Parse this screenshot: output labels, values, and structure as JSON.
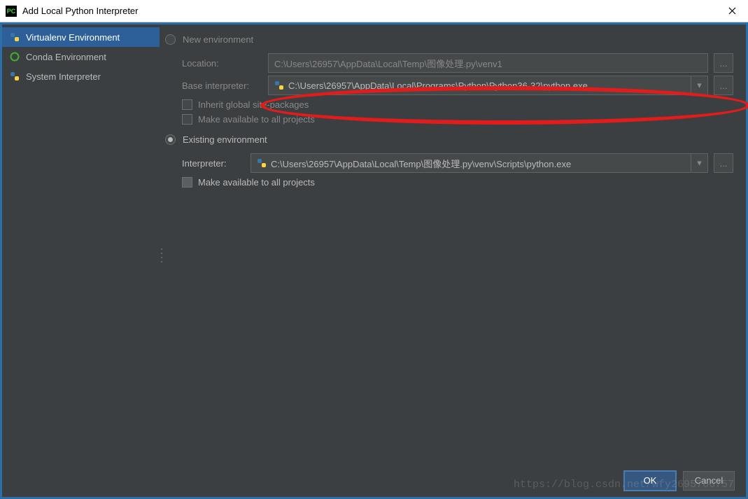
{
  "title": "Add Local Python Interpreter",
  "sidebar": {
    "items": [
      {
        "label": "Virtualenv Environment",
        "icon": "python-icon"
      },
      {
        "label": "Conda Environment",
        "icon": "conda-icon"
      },
      {
        "label": "System Interpreter",
        "icon": "python-icon"
      }
    ],
    "selected": 0
  },
  "new_env": {
    "radio_label": "New environment",
    "location_label": "Location:",
    "location_value": "C:\\Users\\26957\\AppData\\Local\\Temp\\图像处理.py\\venv1",
    "base_label": "Base interpreter:",
    "base_value": "C:\\Users\\26957\\AppData\\Local\\Programs\\Python\\Python36-32\\python.exe",
    "inherit_label": "Inherit global site-packages",
    "make_avail_label": "Make available to all projects"
  },
  "existing_env": {
    "radio_label": "Existing environment",
    "interpreter_label": "Interpreter:",
    "interpreter_value": "C:\\Users\\26957\\AppData\\Local\\Temp\\图像处理.py\\venv\\Scripts\\python.exe",
    "make_avail_label": "Make available to all projects"
  },
  "buttons": {
    "ok": "OK",
    "cancel": "Cancel"
  },
  "watermark": "https://blog.csdn.net/wfy2695766757"
}
